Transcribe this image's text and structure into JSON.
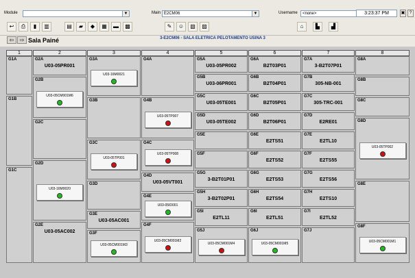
{
  "header": {
    "module_label": "Module",
    "module_value": "",
    "main_label": "Main",
    "main_value": "E2CM06",
    "username_label": "Username",
    "username_value": "<none>",
    "clock": "3:23:37 PM",
    "help": "?"
  },
  "toolbar": {
    "icons": [
      "arrow-icon",
      "printer-icon",
      "trash-icon",
      "chart-icon",
      "books-icon",
      "folder-icon",
      "diamond-icon",
      "gallery-icon",
      "note-icon",
      "grid-icon",
      "pencil-icon",
      "people-icon",
      "photo-icon",
      "image-icon",
      "building-icon",
      "tower-icon",
      "factory-icon"
    ]
  },
  "titlebar": {
    "room": "Sala Painé",
    "title": "3-E2CM06 - SALA ELETRICA PELOTAMENTO USINA 3"
  },
  "colors": {
    "green": "#22bb22",
    "red": "#cc1111"
  },
  "columns": [
    {
      "num": "1",
      "cells": [
        {
          "code": "G1A",
          "title": ""
        },
        {
          "code": "G1B",
          "title": ""
        },
        {
          "code": "G1C",
          "title": ""
        }
      ]
    },
    {
      "num": "2",
      "cells": [
        {
          "code": "G2A",
          "title": "U03-05PR001"
        },
        {
          "code": "G2B",
          "title": "",
          "card": "U03-05CM001M6",
          "status": "green"
        },
        {
          "code": "G2C",
          "title": ""
        },
        {
          "code": "G2D",
          "title": "",
          "card": "U03-16M0020",
          "status": "green"
        },
        {
          "code": "G2E",
          "title": "U03-05AC002"
        }
      ]
    },
    {
      "num": "3",
      "cells": [
        {
          "code": "G3A",
          "title": "",
          "card": "U03-16M0021",
          "status": "green"
        },
        {
          "code": "G3B",
          "title": ""
        },
        {
          "code": "G3C",
          "title": "",
          "card": "U03-05TP001",
          "status": "red"
        },
        {
          "code": "G3D",
          "title": ""
        },
        {
          "code": "G3E",
          "title": "U03-05AC001"
        },
        {
          "code": "G3F",
          "title": "",
          "card": "U03-05CM001M3",
          "status": "green"
        }
      ]
    },
    {
      "num": "4",
      "cells": [
        {
          "code": "G4A",
          "title": ""
        },
        {
          "code": "G4B",
          "title": "",
          "card": "U03-05TP007",
          "status": "red"
        },
        {
          "code": "G4C",
          "title": "",
          "card": "U03-05TP008",
          "status": "red"
        },
        {
          "code": "G4D",
          "title": "U03-05VT001"
        },
        {
          "code": "G4E",
          "title": "",
          "card": "U03-05ID001",
          "status": "green"
        },
        {
          "code": "G4F",
          "title": "",
          "card": "U03-05CM001M2",
          "status": "red"
        }
      ]
    },
    {
      "num": "5",
      "cells": [
        {
          "code": "G5A",
          "title": "U03-05PR002"
        },
        {
          "code": "G5B",
          "title": "U03-06PR001"
        },
        {
          "code": "G5C",
          "title": "U03-05TE001"
        },
        {
          "code": "G5D",
          "title": "U03-05TE002"
        },
        {
          "code": "G5E",
          "title": ""
        },
        {
          "code": "G5F",
          "title": ""
        },
        {
          "code": "G5G",
          "title": "3-B2T01P01"
        },
        {
          "code": "G5H",
          "title": "3-B2T02P01"
        },
        {
          "code": "G5I",
          "title": "E2TL11"
        },
        {
          "code": "G5J",
          "title": "",
          "card": "U03-05CM001M4",
          "status": "red"
        }
      ]
    },
    {
      "num": "6",
      "cells": [
        {
          "code": "G6A",
          "title": "B2T03P01"
        },
        {
          "code": "G6B",
          "title": "B2T04P01"
        },
        {
          "code": "G6C",
          "title": "B2T05P01"
        },
        {
          "code": "G6D",
          "title": "B2T06P01"
        },
        {
          "code": "G6E",
          "title": "E2TS51"
        },
        {
          "code": "G6F",
          "title": "E2TS52"
        },
        {
          "code": "G6G",
          "title": "E2TS53"
        },
        {
          "code": "G6H",
          "title": "E2TS54"
        },
        {
          "code": "G6I",
          "title": "E2TL51"
        },
        {
          "code": "G6J",
          "title": "",
          "card": "U03-05CM001M5",
          "status": "green"
        }
      ]
    },
    {
      "num": "7",
      "cells": [
        {
          "code": "G7A",
          "title": "3-B2T07P01"
        },
        {
          "code": "G7B",
          "title": "305-NB-001"
        },
        {
          "code": "G7C",
          "title": "305-TRC-001"
        },
        {
          "code": "G7D",
          "title": "E2RE01"
        },
        {
          "code": "G7E",
          "title": "E2TL10"
        },
        {
          "code": "G7F",
          "title": "E2TS55"
        },
        {
          "code": "G7G",
          "title": "E2TS56"
        },
        {
          "code": "G7H",
          "title": "E2TS10"
        },
        {
          "code": "G7I",
          "title": "E2TL52"
        },
        {
          "code": "G7J",
          "title": ""
        }
      ]
    },
    {
      "num": "8",
      "cells": [
        {
          "code": "G8A",
          "title": ""
        },
        {
          "code": "G8B",
          "title": ""
        },
        {
          "code": "G8C",
          "title": ""
        },
        {
          "code": "G8D",
          "title": "",
          "card": "U03-05TP002",
          "status": "red"
        },
        {
          "code": "G8E",
          "title": ""
        },
        {
          "code": "G8F",
          "title": "",
          "card": "U03-05CM001M1",
          "status": "green"
        }
      ]
    }
  ]
}
